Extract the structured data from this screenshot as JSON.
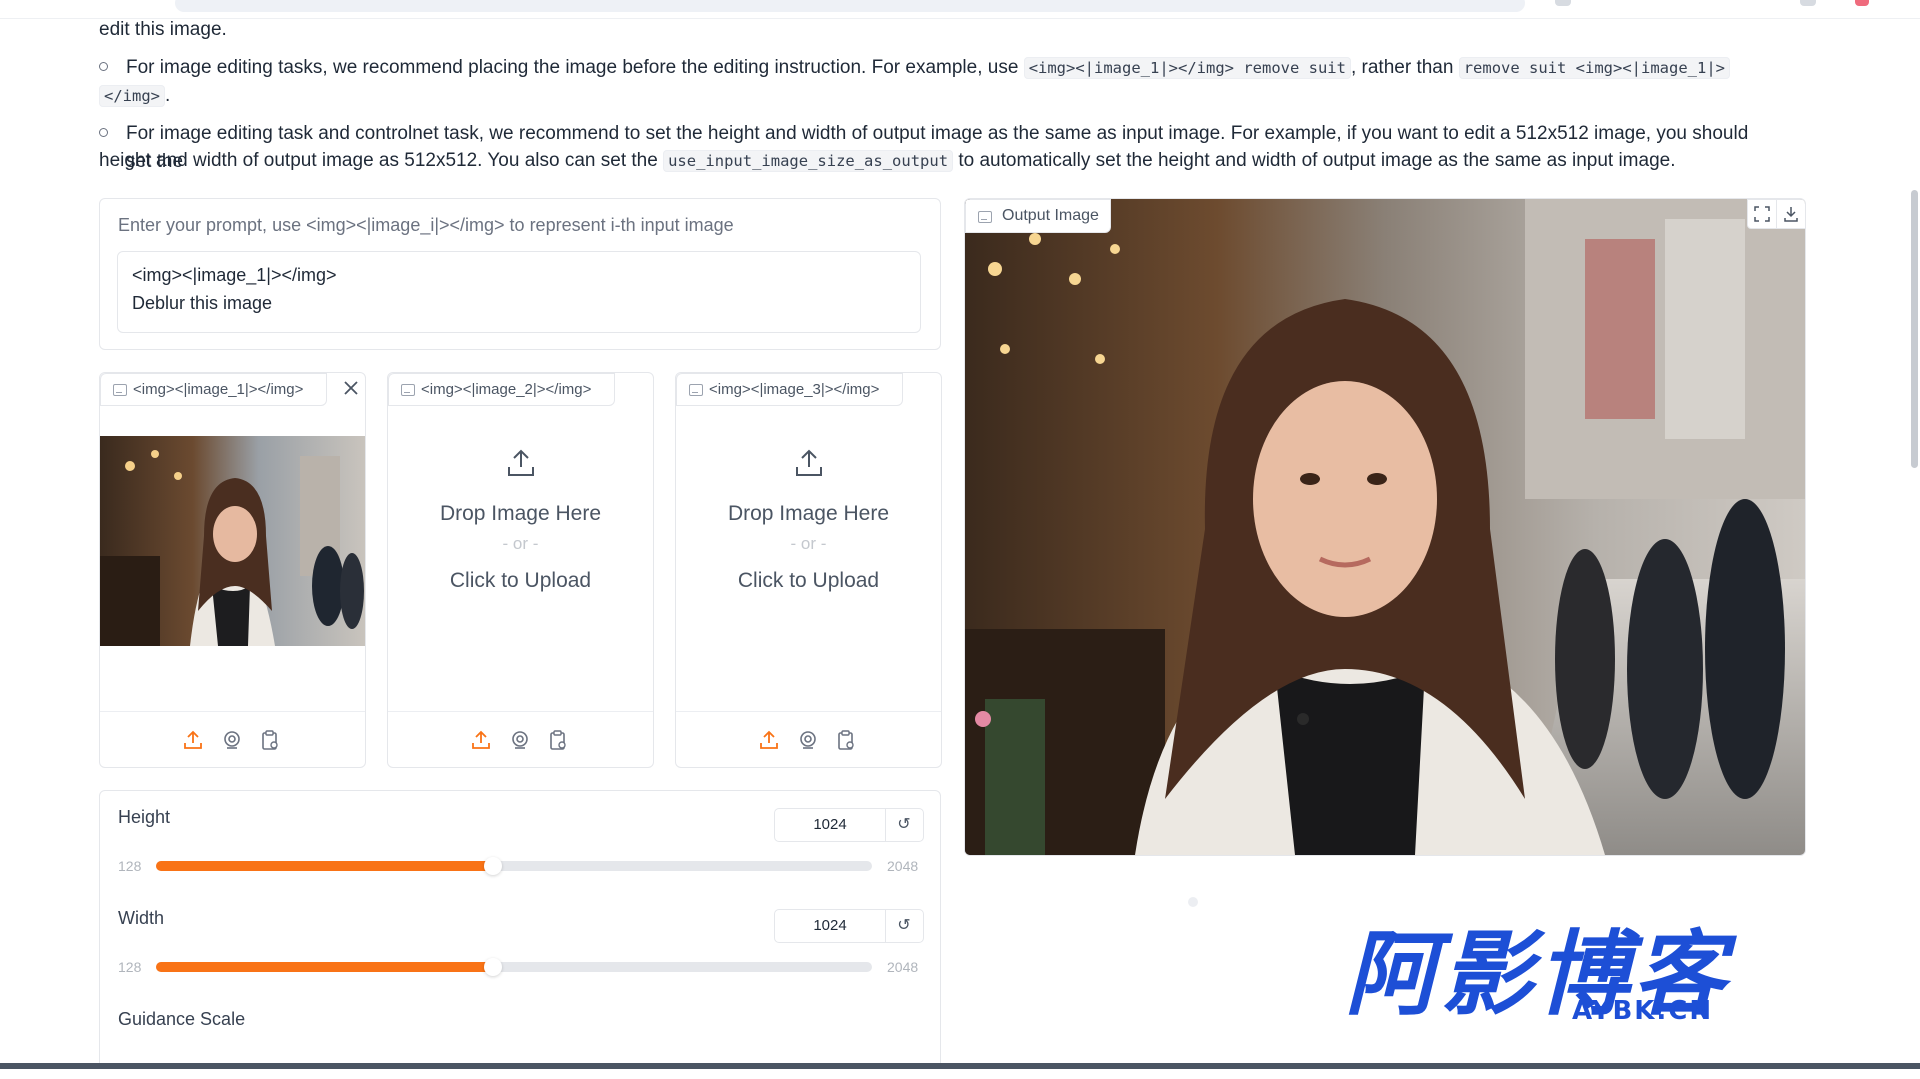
{
  "doc": {
    "line0": "edit this image.",
    "bullet1": {
      "pre": "For image editing tasks, we recommend placing the image before the editing instruction. For example, use ",
      "code1": "<img><|image_1|></img> remove suit",
      "mid": ", rather than ",
      "code2a": "remove suit <img><|image_1|>",
      "code2b": "</img>",
      "post": "."
    },
    "bullet2": {
      "line1": "For image editing task and controlnet task, we recommend to set the height and width of output image as the same as input image. For example, if you want to edit a 512x512 image, you should set the",
      "pre": "height and width of output image as 512x512. You also can set the ",
      "code": "use_input_image_size_as_output",
      "post": " to automatically set the height and width of output image as the same as input image."
    }
  },
  "prompt": {
    "label": "Enter your prompt, use <img><|image_i|></img> to represent i-th input image",
    "line1": "<img><|image_1|></img>",
    "line2": "Deblur this image"
  },
  "inputs": [
    {
      "label": "<img><|image_1|></img>",
      "has_image": true
    },
    {
      "label": "<img><|image_2|></img>",
      "drop": "Drop Image Here",
      "or": "- or -",
      "click": "Click to Upload"
    },
    {
      "label": "<img><|image_3|></img>",
      "drop": "Drop Image Here",
      "or": "- or -",
      "click": "Click to Upload"
    }
  ],
  "sliders": {
    "height": {
      "label": "Height",
      "value": "1024",
      "min": "128",
      "max": "2048",
      "reset": "↺",
      "fraction": 0.4706
    },
    "width": {
      "label": "Width",
      "value": "1024",
      "min": "128",
      "max": "2048",
      "reset": "↺",
      "fraction": 0.4706
    },
    "guidance": {
      "label": "Guidance Scale"
    }
  },
  "output": {
    "label": "Output Image"
  },
  "watermark": {
    "cn": "阿影博客",
    "en": "AYBK.CN"
  },
  "colors": {
    "accent": "#f97316",
    "watermark": "#1d4fd6"
  },
  "icons": [
    "upload-icon",
    "webcam-icon",
    "clipboard-icon",
    "close-icon",
    "fullscreen-icon",
    "download-icon",
    "image-icon",
    "reset-icon"
  ]
}
